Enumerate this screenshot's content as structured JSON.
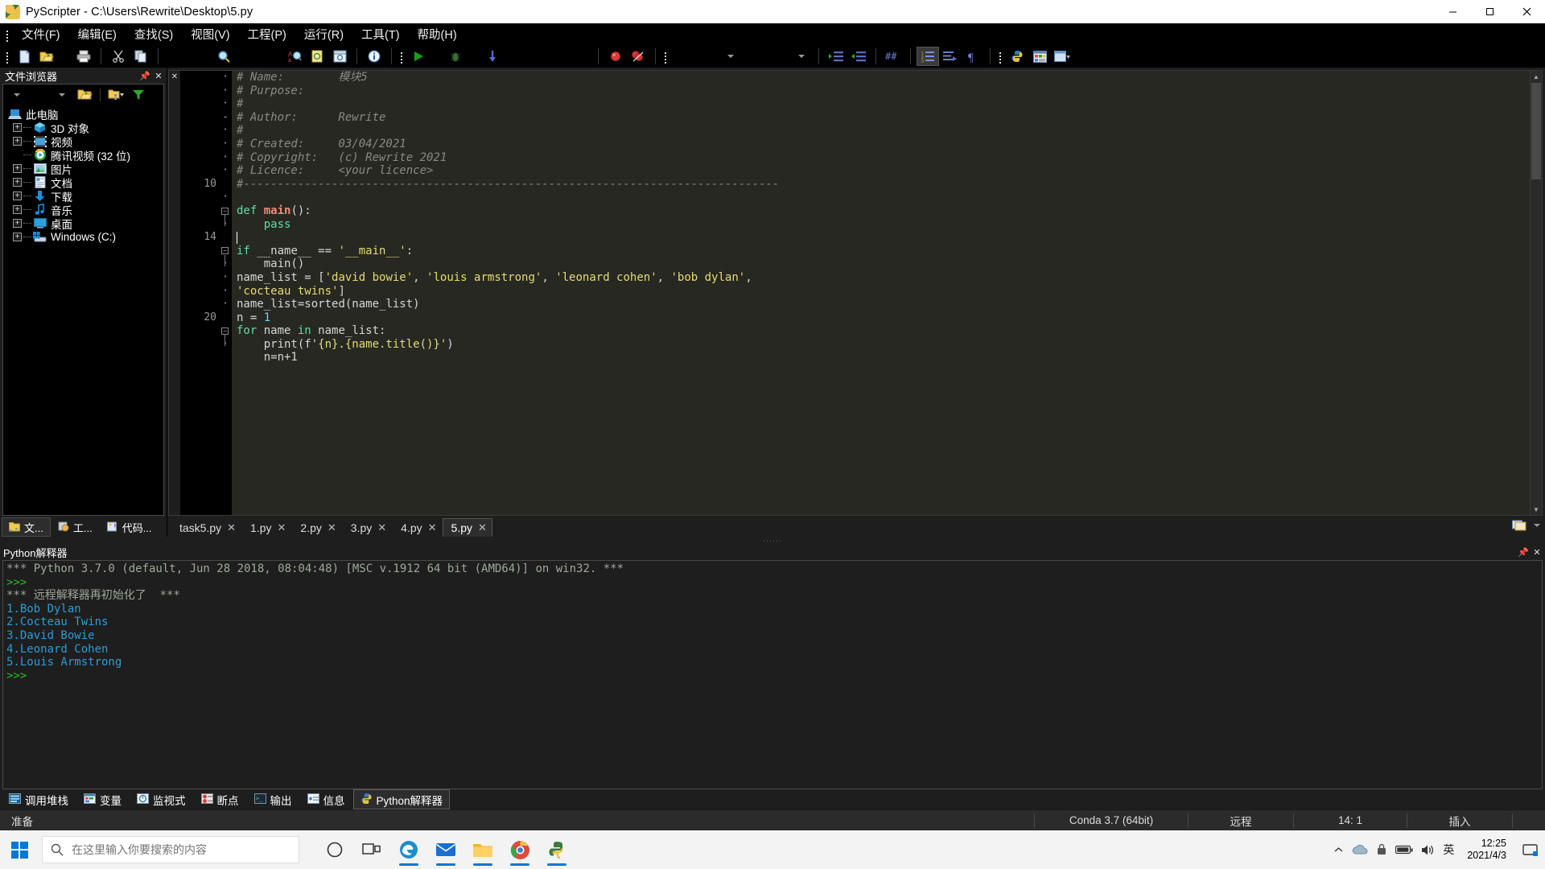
{
  "window": {
    "title": "PyScripter - C:\\Users\\Rewrite\\Desktop\\5.py",
    "app_icon": "python-snake-icon",
    "minimize": "–",
    "maximize": "▢",
    "close": "✕"
  },
  "menubar": {
    "items": [
      {
        "label": "文件(F)",
        "name": "menu-file"
      },
      {
        "label": "编辑(E)",
        "name": "menu-edit"
      },
      {
        "label": "查找(S)",
        "name": "menu-search"
      },
      {
        "label": "视图(V)",
        "name": "menu-view"
      },
      {
        "label": "工程(P)",
        "name": "menu-project"
      },
      {
        "label": "运行(R)",
        "name": "menu-run"
      },
      {
        "label": "工具(T)",
        "name": "menu-tools"
      },
      {
        "label": "帮助(H)",
        "name": "menu-help"
      }
    ]
  },
  "toolbar": {
    "buttons": [
      "new-file-icon",
      "open-file-icon",
      "print-icon",
      "cut-icon",
      "copy-icon",
      "find-icon",
      "find-replace-icon",
      "highlight-icon",
      "goto-line-icon",
      "info-icon",
      "run-icon",
      "debug-icon",
      "step-into-icon",
      "breakpoint-icon",
      "clear-breakpoints-icon",
      "dropdown-1-icon",
      "dropdown-2-icon",
      "indent-icon",
      "unindent-icon",
      "comment-icon",
      "code-explorer-icon",
      "todo-icon",
      "paragraph-icon",
      "python-interpreter-icon",
      "variables-icon",
      "layout-icon"
    ]
  },
  "file_browser": {
    "title": "文件浏览器",
    "pin_icon": "pin-icon",
    "close_icon": "close-icon",
    "toolbar": [
      "back-dropdown-icon",
      "forward-dropdown-icon",
      "open-folder-icon",
      "folder-options-icon",
      "filter-icon"
    ],
    "tree": [
      {
        "label": "此电脑",
        "icon": "computer-icon",
        "level": 0,
        "expander": "none"
      },
      {
        "label": "3D 对象",
        "icon": "cube-icon",
        "level": 1,
        "expander": "+"
      },
      {
        "label": "视频",
        "icon": "video-icon",
        "level": 1,
        "expander": "+"
      },
      {
        "label": "腾讯视频 (32 位)",
        "icon": "tencent-video-icon",
        "level": 1,
        "expander": "none"
      },
      {
        "label": "图片",
        "icon": "pictures-icon",
        "level": 1,
        "expander": "+"
      },
      {
        "label": "文档",
        "icon": "documents-icon",
        "level": 1,
        "expander": "+"
      },
      {
        "label": "下载",
        "icon": "downloads-icon",
        "level": 1,
        "expander": "+"
      },
      {
        "label": "音乐",
        "icon": "music-icon",
        "level": 1,
        "expander": "+"
      },
      {
        "label": "桌面",
        "icon": "desktop-icon",
        "level": 1,
        "expander": "+"
      },
      {
        "label": "Windows (C:)",
        "icon": "drive-icon",
        "level": 1,
        "expander": "+"
      }
    ],
    "dock_tabs": [
      {
        "label": "文...",
        "icon": "file-explorer-icon",
        "active": true
      },
      {
        "label": "工...",
        "icon": "project-icon",
        "active": false
      },
      {
        "label": "代码...",
        "icon": "code-explorer-icon",
        "active": false
      }
    ]
  },
  "editor": {
    "tabs": [
      {
        "label": "task5.py",
        "active": false,
        "close": "✕"
      },
      {
        "label": "1.py",
        "active": false,
        "close": "✕"
      },
      {
        "label": "2.py",
        "active": false,
        "close": "✕"
      },
      {
        "label": "3.py",
        "active": false,
        "close": "✕"
      },
      {
        "label": "4.py",
        "active": false,
        "close": "✕"
      },
      {
        "label": "5.py",
        "active": true,
        "close": "✕"
      }
    ],
    "tab_right_icons": [
      "tab-list-icon",
      "tab-dropdown-icon"
    ],
    "gutter_numbers": [
      "",
      "",
      "",
      "",
      "",
      "",
      "",
      "",
      "10",
      "",
      "",
      "",
      "14",
      "",
      "",
      "",
      "",
      "",
      "20",
      "",
      ""
    ],
    "gutter_marks": [
      "·",
      "·",
      "·",
      "-",
      "·",
      "·",
      "·",
      "·",
      "",
      "·",
      "·",
      "·",
      "",
      "-",
      "·",
      "·",
      "·",
      "·",
      "",
      "·",
      "·"
    ],
    "lines": [
      {
        "tokens": [
          {
            "t": "# Name:        模块5",
            "c": "cm"
          }
        ]
      },
      {
        "tokens": [
          {
            "t": "# Purpose:",
            "c": "cm"
          }
        ]
      },
      {
        "tokens": [
          {
            "t": "#",
            "c": "cm"
          }
        ]
      },
      {
        "tokens": [
          {
            "t": "# Author:      Rewrite",
            "c": "cm"
          }
        ]
      },
      {
        "tokens": [
          {
            "t": "#",
            "c": "cm"
          }
        ]
      },
      {
        "tokens": [
          {
            "t": "# Created:     03/04/2021",
            "c": "cm"
          }
        ]
      },
      {
        "tokens": [
          {
            "t": "# Copyright:   (c) Rewrite 2021",
            "c": "cm"
          }
        ]
      },
      {
        "tokens": [
          {
            "t": "# Licence:     <your licence>",
            "c": "cm"
          }
        ]
      },
      {
        "tokens": [
          {
            "t": "#-------------------------------------------------------------------------------",
            "c": "cm"
          }
        ]
      },
      {
        "tokens": [
          {
            "t": "",
            "c": "nm"
          }
        ]
      },
      {
        "tokens": [
          {
            "t": "def ",
            "c": "kw"
          },
          {
            "t": "main",
            "c": "fn"
          },
          {
            "t": "():",
            "c": "op"
          }
        ]
      },
      {
        "tokens": [
          {
            "t": "    pass",
            "c": "kw"
          }
        ]
      },
      {
        "tokens": [
          {
            "t": "",
            "c": "nm"
          }
        ]
      },
      {
        "tokens": [
          {
            "t": "if ",
            "c": "kw"
          },
          {
            "t": "__name__ ",
            "c": "nm"
          },
          {
            "t": "== ",
            "c": "op"
          },
          {
            "t": "'__main__'",
            "c": "st"
          },
          {
            "t": ":",
            "c": "op"
          }
        ]
      },
      {
        "tokens": [
          {
            "t": "    main()",
            "c": "nm"
          }
        ]
      },
      {
        "tokens": [
          {
            "t": "name_list ",
            "c": "nm"
          },
          {
            "t": "= ",
            "c": "op"
          },
          {
            "t": "[",
            "c": "op"
          },
          {
            "t": "'david bowie'",
            "c": "st"
          },
          {
            "t": ", ",
            "c": "op"
          },
          {
            "t": "'louis armstrong'",
            "c": "st"
          },
          {
            "t": ", ",
            "c": "op"
          },
          {
            "t": "'leonard cohen'",
            "c": "st"
          },
          {
            "t": ", ",
            "c": "op"
          },
          {
            "t": "'bob dylan'",
            "c": "st"
          },
          {
            "t": ",",
            "c": "op"
          }
        ]
      },
      {
        "tokens": [
          {
            "t": "'cocteau twins'",
            "c": "st"
          },
          {
            "t": "]",
            "c": "op"
          }
        ]
      },
      {
        "tokens": [
          {
            "t": "name_list",
            "c": "nm"
          },
          {
            "t": "=",
            "c": "op"
          },
          {
            "t": "sorted",
            "c": "nm"
          },
          {
            "t": "(name_list)",
            "c": "op"
          }
        ]
      },
      {
        "tokens": [
          {
            "t": "n ",
            "c": "nm"
          },
          {
            "t": "= ",
            "c": "op"
          },
          {
            "t": "1",
            "c": "bi"
          }
        ]
      },
      {
        "tokens": [
          {
            "t": "for ",
            "c": "kw"
          },
          {
            "t": "name ",
            "c": "nm"
          },
          {
            "t": "in ",
            "c": "kw"
          },
          {
            "t": "name_list:",
            "c": "nm"
          }
        ]
      },
      {
        "tokens": [
          {
            "t": "    print(f",
            "c": "nm"
          },
          {
            "t": "'{n}.{name.title()}'",
            "c": "st"
          },
          {
            "t": ")",
            "c": "op"
          }
        ]
      },
      {
        "tokens": [
          {
            "t": "    n=n+1",
            "c": "nm"
          }
        ]
      }
    ]
  },
  "interpreter": {
    "title": "Python解释器",
    "pin_icon": "pin-icon",
    "close_icon": "close-icon",
    "output": [
      {
        "text": "*** Python 3.7.0 (default, Jun 28 2018, 08:04:48) [MSC v.1912 64 bit (AMD64)] on win32. ***",
        "style": "out-sys"
      },
      {
        "text": ">>>",
        "style": "out-prompt"
      },
      {
        "text": "*** 远程解释器再初始化了  ***",
        "style": "out-sys"
      },
      {
        "text": "1.Bob Dylan",
        "style": "out-val"
      },
      {
        "text": "2.Cocteau Twins",
        "style": "out-val"
      },
      {
        "text": "3.David Bowie",
        "style": "out-val"
      },
      {
        "text": "4.Leonard Cohen",
        "style": "out-val"
      },
      {
        "text": "5.Louis Armstrong",
        "style": "out-val"
      },
      {
        "text": ">>>",
        "style": "out-prompt"
      }
    ],
    "tabs": [
      {
        "label": "调用堆栈",
        "icon": "call-stack-icon",
        "active": false
      },
      {
        "label": "变量",
        "icon": "variables-icon",
        "active": false
      },
      {
        "label": "监视式",
        "icon": "watches-icon",
        "active": false
      },
      {
        "label": "断点",
        "icon": "breakpoints-icon",
        "active": false
      },
      {
        "label": "输出",
        "icon": "output-icon",
        "active": false
      },
      {
        "label": "信息",
        "icon": "messages-icon",
        "active": false
      },
      {
        "label": "Python解释器",
        "icon": "python-icon",
        "active": true
      }
    ]
  },
  "statusbar": {
    "state": "准备",
    "interpreter": "Conda 3.7 (64bit)",
    "mode": "远程",
    "position": "14:  1",
    "insert": "插入"
  },
  "taskbar": {
    "start_icon": "windows-logo-icon",
    "search_placeholder": "在这里输入你要搜索的内容",
    "search_value": "",
    "search_icon": "search-icon",
    "buttons": [
      {
        "name": "cortana-icon",
        "running": false
      },
      {
        "name": "task-view-icon",
        "running": false
      },
      {
        "name": "edge-icon",
        "running": true
      },
      {
        "name": "mail-icon",
        "running": true
      },
      {
        "name": "file-explorer-icon",
        "running": true
      },
      {
        "name": "chrome-icon",
        "running": true
      },
      {
        "name": "pyscripter-icon",
        "running": true
      }
    ],
    "tray": [
      "chevron-up-icon",
      "onedrive-icon",
      "security-icon",
      "battery-icon",
      "volume-icon"
    ],
    "ime": "英",
    "time": "12:25",
    "date": "2021/4/3",
    "notification_icon": "notification-icon"
  },
  "colors": {
    "accent": "#0078d7",
    "editor_bg": "#272822",
    "comment": "#8a8a82",
    "keyword": "#66d9a0",
    "string": "#e6db74",
    "function": "#f08a7a",
    "output_value": "#2e9bd6",
    "output_prompt": "#1ec41e"
  }
}
